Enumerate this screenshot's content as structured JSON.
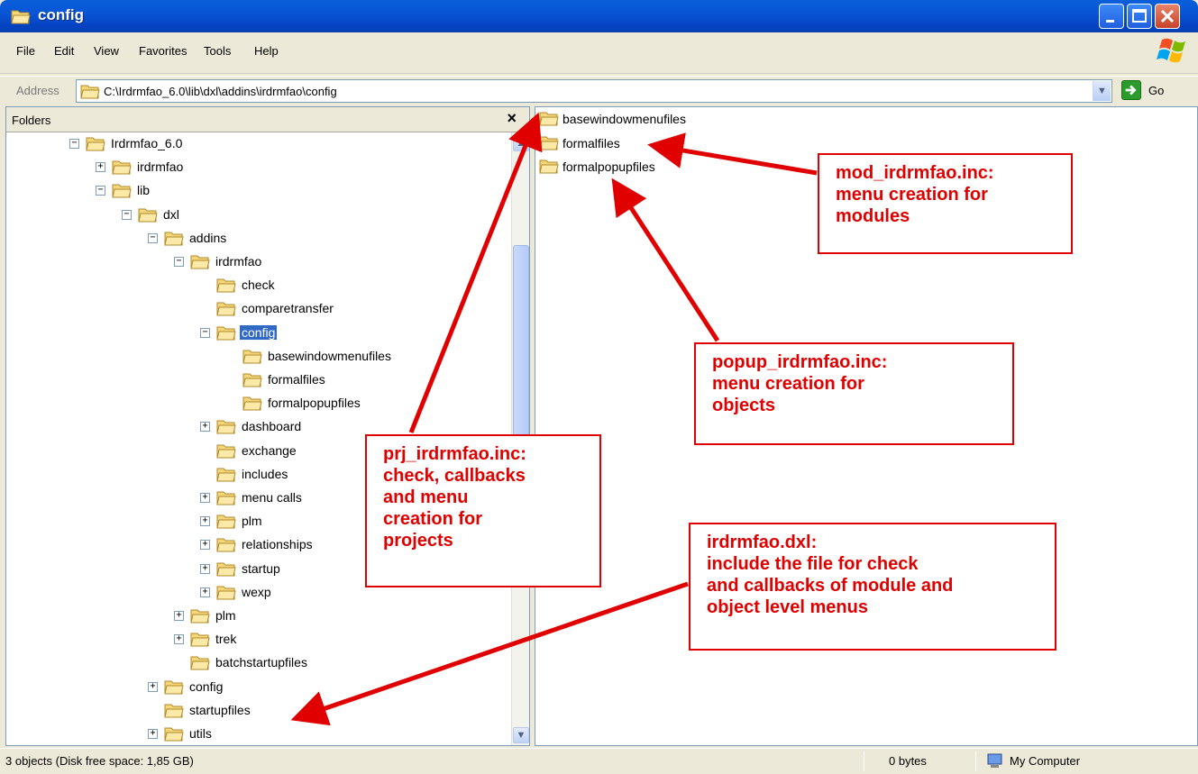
{
  "window": {
    "title": "config"
  },
  "menu": [
    "File",
    "Edit",
    "View",
    "Favorites",
    "Tools",
    "Help"
  ],
  "address": {
    "label": "Address",
    "path": "C:\\Irdrmfao_6.0\\lib\\dxl\\addins\\irdrmfao\\config",
    "go_label": "Go"
  },
  "folders_pane": {
    "title": "Folders",
    "close_glyph": "×"
  },
  "tree": [
    {
      "label": "Irdrmfao_6.0",
      "depth": 0,
      "exp": "−"
    },
    {
      "label": "irdrmfao",
      "depth": 1,
      "exp": "+"
    },
    {
      "label": "lib",
      "depth": 1,
      "exp": "−"
    },
    {
      "label": "dxl",
      "depth": 2,
      "exp": "−"
    },
    {
      "label": "addins",
      "depth": 3,
      "exp": "−"
    },
    {
      "label": "irdrmfao",
      "depth": 4,
      "exp": "−"
    },
    {
      "label": "check",
      "depth": 5,
      "exp": ""
    },
    {
      "label": "comparetransfer",
      "depth": 5,
      "exp": ""
    },
    {
      "label": "config",
      "depth": 5,
      "exp": "−",
      "selected": true
    },
    {
      "label": "basewindowmenufiles",
      "depth": 6,
      "exp": ""
    },
    {
      "label": "formalfiles",
      "depth": 6,
      "exp": ""
    },
    {
      "label": "formalpopupfiles",
      "depth": 6,
      "exp": ""
    },
    {
      "label": "dashboard",
      "depth": 5,
      "exp": "+"
    },
    {
      "label": "exchange",
      "depth": 5,
      "exp": ""
    },
    {
      "label": "includes",
      "depth": 5,
      "exp": ""
    },
    {
      "label": "menu calls",
      "depth": 5,
      "exp": "+"
    },
    {
      "label": "plm",
      "depth": 5,
      "exp": "+"
    },
    {
      "label": "relationships",
      "depth": 5,
      "exp": "+"
    },
    {
      "label": "startup",
      "depth": 5,
      "exp": "+"
    },
    {
      "label": "wexp",
      "depth": 5,
      "exp": "+"
    },
    {
      "label": "plm",
      "depth": 4,
      "exp": "+"
    },
    {
      "label": "trek",
      "depth": 4,
      "exp": "+"
    },
    {
      "label": "batchstartupfiles",
      "depth": 4,
      "exp": ""
    },
    {
      "label": "config",
      "depth": 3,
      "exp": "+"
    },
    {
      "label": "startupfiles",
      "depth": 3,
      "exp": ""
    },
    {
      "label": "utils",
      "depth": 3,
      "exp": "+"
    }
  ],
  "content_items": [
    "basewindowmenufiles",
    "formalfiles",
    "formalpopupfiles"
  ],
  "status": {
    "objects": "3 objects (Disk free space: 1,85 GB)",
    "size": "0 bytes",
    "zone": "My Computer"
  },
  "annotations": {
    "mod": [
      "mod_irdrmfao.inc:",
      "menu creation for",
      "modules"
    ],
    "popup": [
      "popup_irdrmfao.inc:",
      "menu creation for",
      "objects"
    ],
    "prj": [
      "prj_irdrmfao.inc:",
      "check, callbacks",
      "and menu",
      "creation for",
      "projects"
    ],
    "dxl": [
      "irdrmfao.dxl:",
      "include the file for check",
      "and callbacks of module and",
      "object level menus"
    ]
  },
  "colors": {
    "selection": "#316AC5",
    "annotation": "#e00000",
    "folder": "#F5D77A",
    "titlebar": "#0755d6"
  }
}
